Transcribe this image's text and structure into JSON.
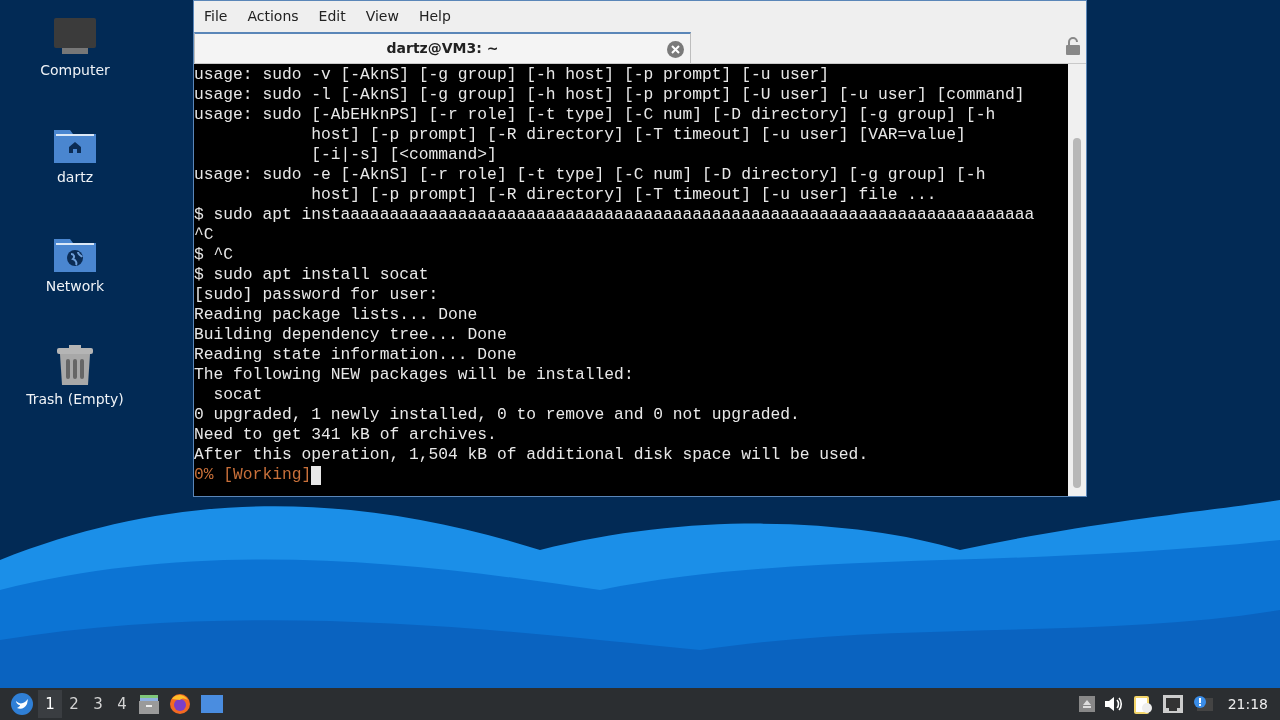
{
  "desktop_icons": [
    {
      "label": "Computer",
      "kind": "computer"
    },
    {
      "label": "dartz",
      "kind": "home"
    },
    {
      "label": "Network",
      "kind": "network"
    },
    {
      "label": "Trash (Empty)",
      "kind": "trash"
    }
  ],
  "window": {
    "menu": [
      "File",
      "Actions",
      "Edit",
      "View",
      "Help"
    ],
    "tabs": [
      {
        "title": "dartz@VM3: ~",
        "selected": true
      }
    ],
    "terminal_lines": [
      {
        "kind": "output",
        "text": "usage: sudo -v [-AknS] [-g group] [-h host] [-p prompt] [-u user]"
      },
      {
        "kind": "output",
        "text": "usage: sudo -l [-AknS] [-g group] [-h host] [-p prompt] [-U user] [-u user] [command]"
      },
      {
        "kind": "output",
        "text": "usage: sudo [-AbEHknPS] [-r role] [-t type] [-C num] [-D directory] [-g group] [-h"
      },
      {
        "kind": "output",
        "text": "            host] [-p prompt] [-R directory] [-T timeout] [-u user] [VAR=value]"
      },
      {
        "kind": "output",
        "text": "            [-i|-s] [<command>]"
      },
      {
        "kind": "output",
        "text": "usage: sudo -e [-AknS] [-r role] [-t type] [-C num] [-D directory] [-g group] [-h"
      },
      {
        "kind": "output",
        "text": "            host] [-p prompt] [-R directory] [-T timeout] [-u user] file ..."
      },
      {
        "kind": "output",
        "text": "$ sudo apt instaaaaaaaaaaaaaaaaaaaaaaaaaaaaaaaaaaaaaaaaaaaaaaaaaaaaaaaaaaaaaaaaaaaaaaa"
      },
      {
        "kind": "output",
        "text": "^C"
      },
      {
        "kind": "output",
        "text": "$ ^C"
      },
      {
        "kind": "output",
        "text": "$ sudo apt install socat"
      },
      {
        "kind": "output",
        "text": "[sudo] password for user:"
      },
      {
        "kind": "output",
        "text": "Reading package lists... Done"
      },
      {
        "kind": "output",
        "text": "Building dependency tree... Done"
      },
      {
        "kind": "output",
        "text": "Reading state information... Done"
      },
      {
        "kind": "output",
        "text": "The following NEW packages will be installed:"
      },
      {
        "kind": "output",
        "text": "  socat"
      },
      {
        "kind": "output",
        "text": "0 upgraded, 1 newly installed, 0 to remove and 0 not upgraded."
      },
      {
        "kind": "output",
        "text": "Need to get 341 kB of archives."
      },
      {
        "kind": "output",
        "text": "After this operation, 1,504 kB of additional disk space will be used."
      },
      {
        "kind": "progress",
        "text": "0% [Working]"
      }
    ]
  },
  "taskbar": {
    "workspaces": [
      {
        "label": "1",
        "selected": true
      },
      {
        "label": "2",
        "selected": false
      },
      {
        "label": "3",
        "selected": false
      },
      {
        "label": "4",
        "selected": false
      }
    ],
    "clock": "21:18"
  }
}
